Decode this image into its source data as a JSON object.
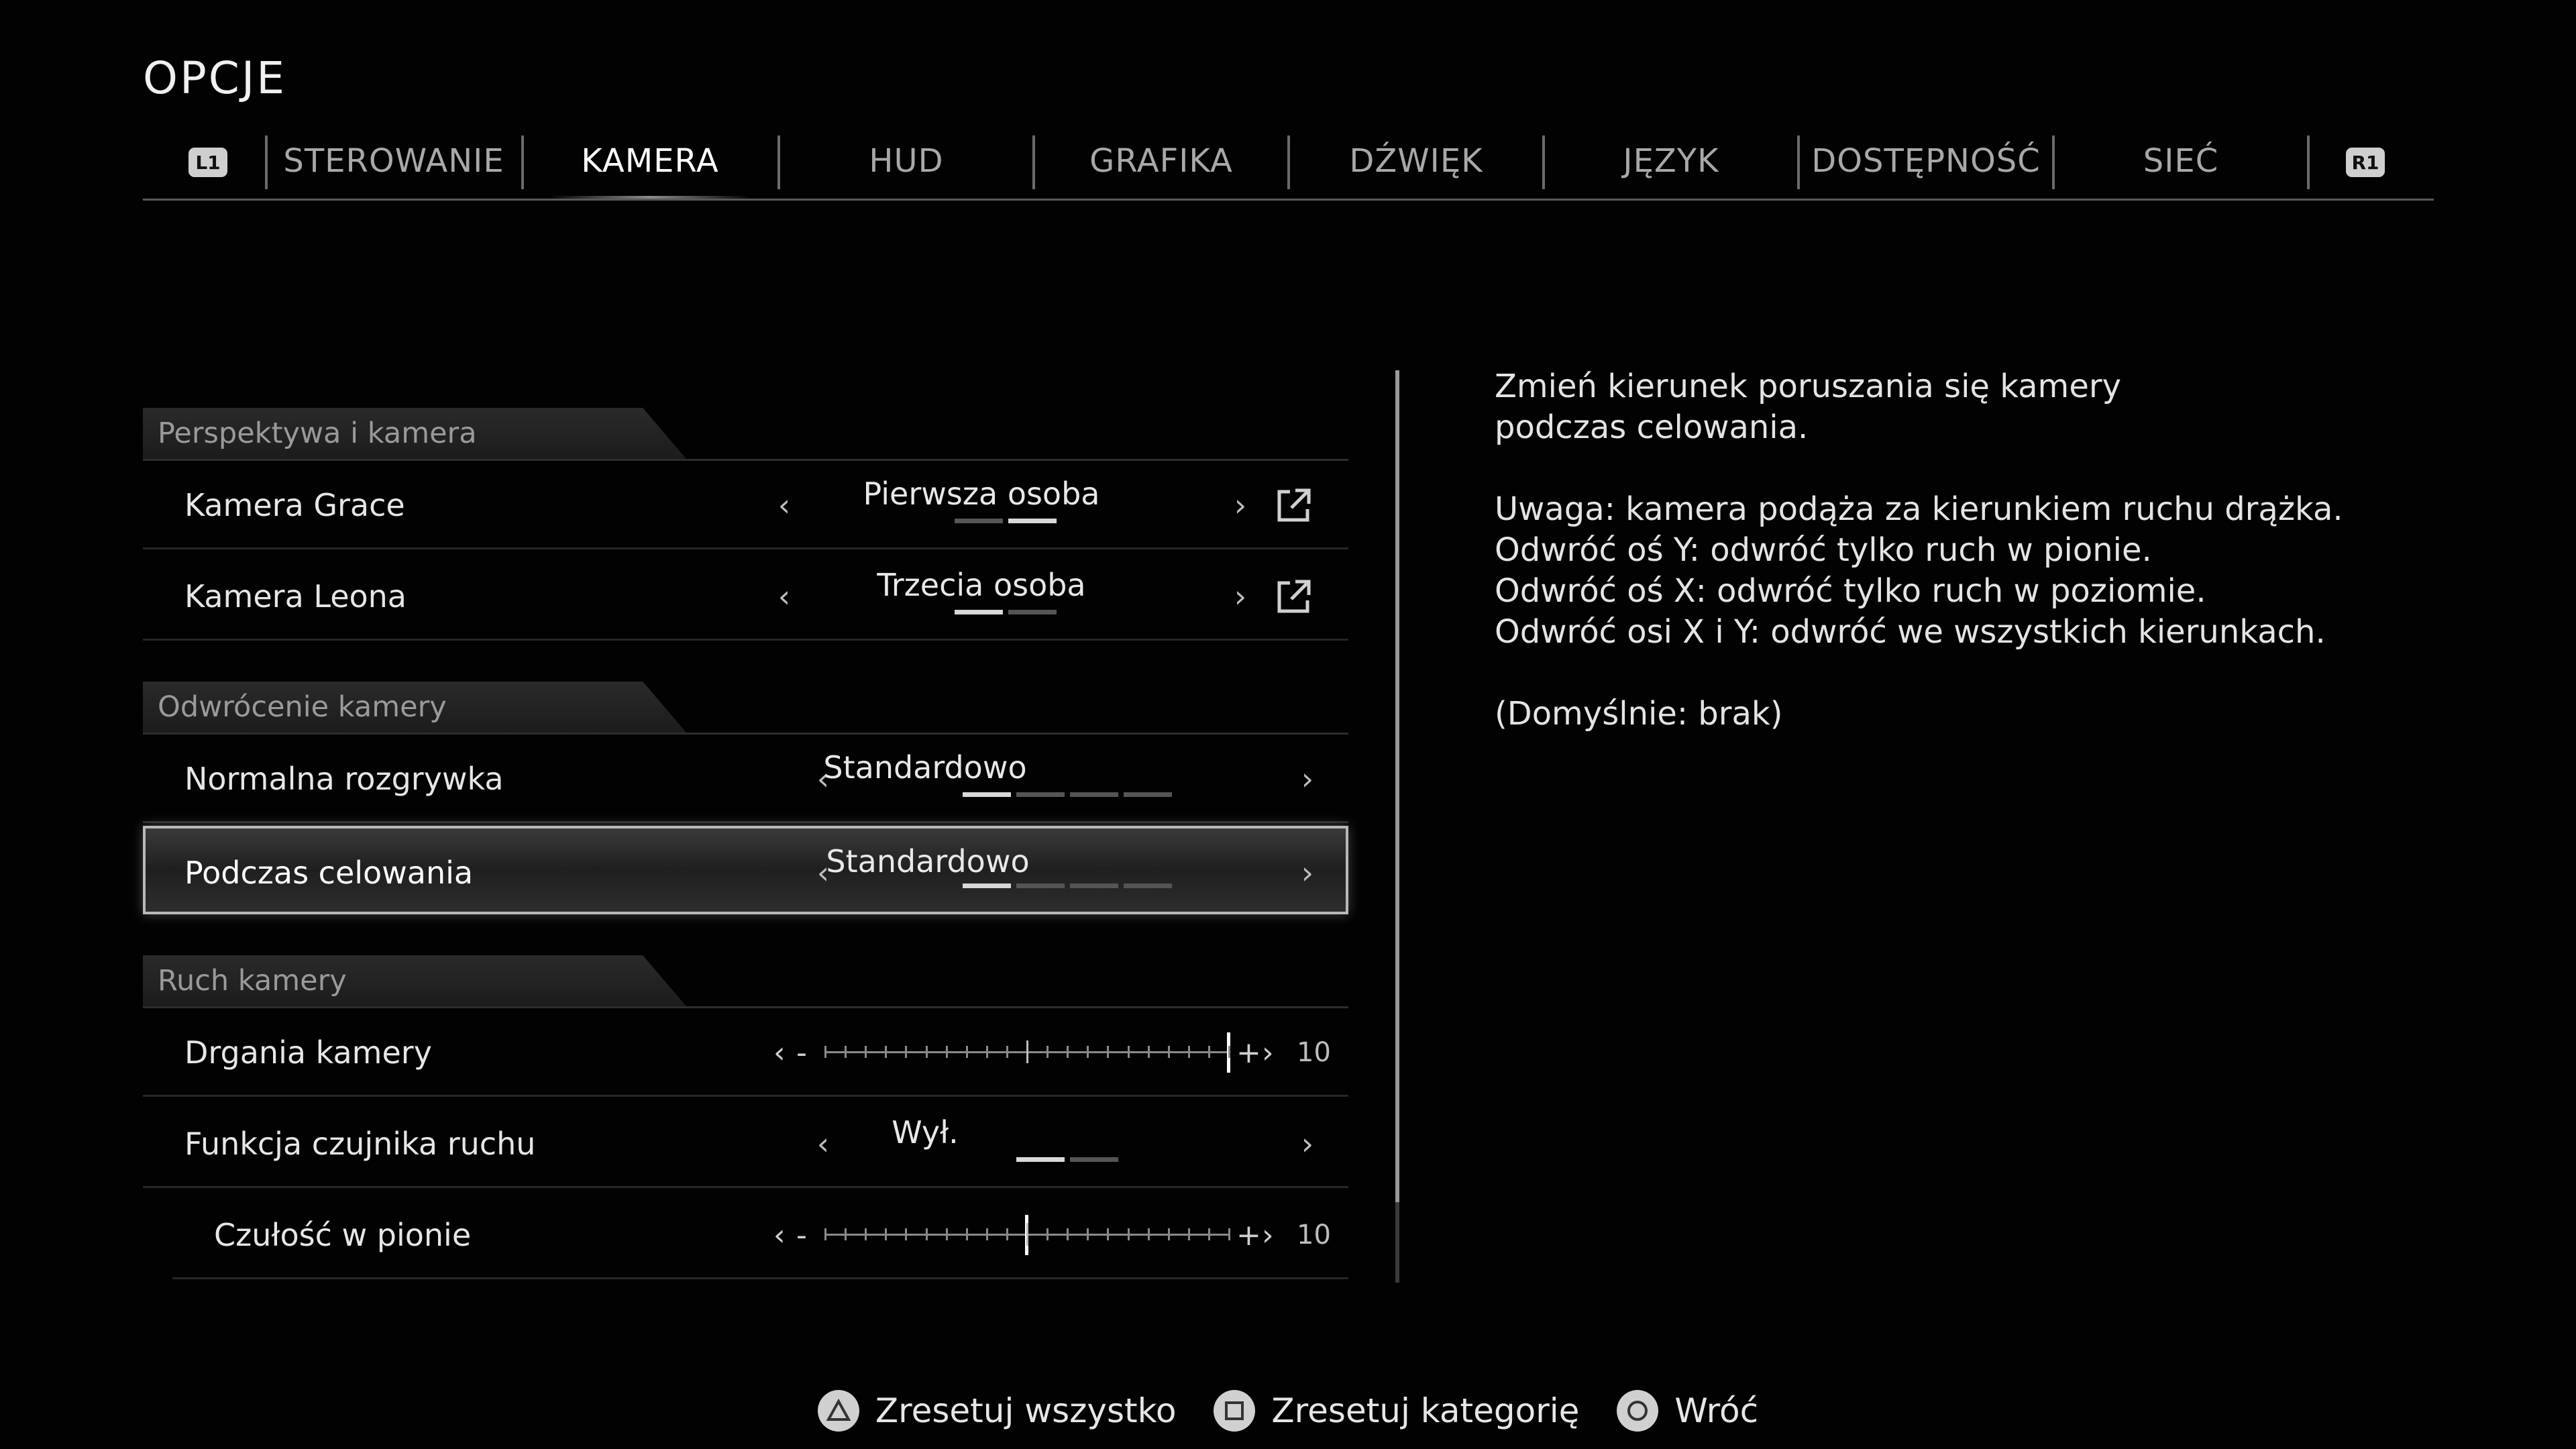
{
  "title": "OPCJE",
  "tabs": {
    "left_bumper": "L1",
    "right_bumper": "R1",
    "items": [
      {
        "label": "STEROWANIE"
      },
      {
        "label": "KAMERA"
      },
      {
        "label": "HUD"
      },
      {
        "label": "GRAFIKA"
      },
      {
        "label": "DŹWIĘK"
      },
      {
        "label": "JĘZYK"
      },
      {
        "label": "DOSTĘPNOŚĆ"
      },
      {
        "label": "SIEĆ"
      }
    ],
    "active": "KAMERA"
  },
  "sections": [
    {
      "title": "Perspektywa i kamera",
      "rows": [
        {
          "label": "Kamera Grace",
          "value": "Pierwsza osoba",
          "option_count": 2,
          "selected_index": 1
        },
        {
          "label": "Kamera Leona",
          "value": "Trzecia osoba",
          "option_count": 2,
          "selected_index": 0
        }
      ]
    },
    {
      "title": "Odwrócenie kamery",
      "rows": [
        {
          "label": "Normalna rozgrywka",
          "value": "Standardowo",
          "option_count": 4,
          "selected_index": 0
        },
        {
          "label": "Podczas celowania",
          "value": "Standardowo",
          "option_count": 4,
          "selected_index": 0,
          "selected": true
        }
      ]
    },
    {
      "title": "Ruch kamery",
      "rows": [
        {
          "label": "Drgania kamery",
          "slider_value": "10",
          "slider_fraction": 1.0
        },
        {
          "label": "Funkcja czujnika ruchu",
          "value": "Wył.",
          "option_count": 2,
          "selected_index": 0
        },
        {
          "label": "Czułość w pionie",
          "slider_value": "10",
          "slider_fraction": 0.5
        }
      ]
    }
  ],
  "slider_symbols": {
    "minus": "-",
    "plus": "+"
  },
  "arrows": {
    "left": "‹",
    "right": "›"
  },
  "description": {
    "line1": "Zmień kierunek poruszania się kamery",
    "line2": "podczas celowania.",
    "line3": "Uwaga: kamera podąża za kierunkiem ruchu drążka.",
    "line4": "Odwróć oś Y: odwróć tylko ruch w pionie.",
    "line5": "Odwróć oś X: odwróć tylko ruch w poziomie.",
    "line6": "Odwróć osi X i Y: odwróć we wszystkich kierunkach.",
    "line7": "(Domyślnie: brak)"
  },
  "footer": {
    "reset_all": "Zresetuj wszystko",
    "reset_category": "Zresetuj kategorię",
    "back": "Wróć"
  },
  "icons": {
    "triangle": "triangle-button-icon",
    "square": "square-button-icon",
    "circle": "circle-button-icon",
    "external": "external-link-icon"
  },
  "colors": {
    "background": "#020202",
    "text": "#e6e6e6",
    "accent": "#ffffff",
    "muted": "#9a9a9a"
  }
}
